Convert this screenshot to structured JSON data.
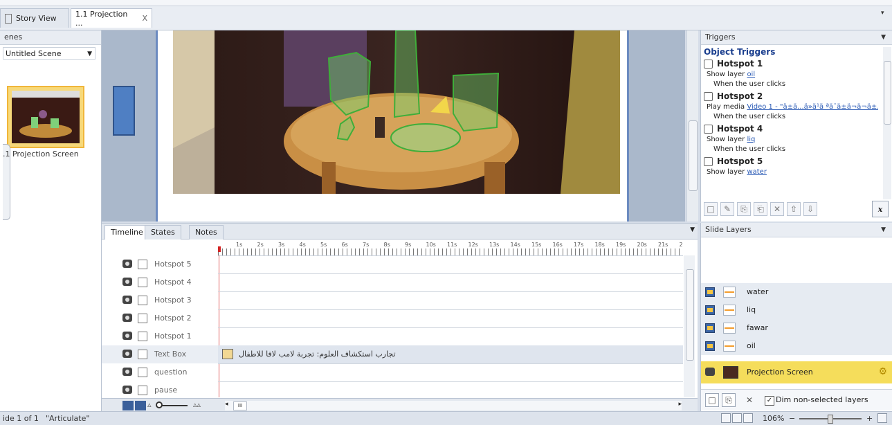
{
  "tabs": [
    {
      "label": "Story View",
      "active": false
    },
    {
      "label": "1.1 Projection ...",
      "active": true,
      "close": "X"
    }
  ],
  "scenes": {
    "header": "enes",
    "selected_scene": "Untitled Scene",
    "slide_label": ".1 Projection Screen"
  },
  "triggers": {
    "header": "Triggers",
    "section_title": "Object Triggers",
    "items": [
      {
        "hotspot": "Hotspot 1",
        "action": "Show layer ",
        "target": "oil",
        "when": "When the user clicks"
      },
      {
        "hotspot": "Hotspot 2",
        "action": "Play media ",
        "target": "Video 1 - \"ä±ä...ä»ä¹ä ªä¨ä±ä¬ä¬ä±...",
        "when": "When the user clicks"
      },
      {
        "hotspot": "Hotspot 4",
        "action": "Show layer ",
        "target": "liq",
        "when": "When the user clicks"
      },
      {
        "hotspot": "Hotspot 5",
        "action": "Show layer ",
        "target": "water",
        "when": ""
      }
    ],
    "variable_button": "x"
  },
  "timeline": {
    "tabs": [
      "Timeline",
      "States",
      "Notes"
    ],
    "ruler": [
      "1s",
      "2s",
      "3s",
      "4s",
      "5s",
      "6s",
      "7s",
      "8s",
      "9s",
      "10s",
      "11s",
      "12s",
      "13s",
      "14s",
      "15s",
      "16s",
      "17s",
      "18s",
      "19s",
      "20s",
      "21s",
      "2"
    ],
    "rows": [
      {
        "name": "Hotspot 5"
      },
      {
        "name": "Hotspot 4"
      },
      {
        "name": "Hotspot 3"
      },
      {
        "name": "Hotspot 2"
      },
      {
        "name": "Hotspot 1"
      },
      {
        "name": "Text Box",
        "text": "تجارب استكشاف العلوم: تجربة  لامب لافا للاطفال"
      },
      {
        "name": "question"
      },
      {
        "name": "pause"
      }
    ],
    "hscroll_thumb": "III"
  },
  "layers": {
    "header": "Slide Layers",
    "items": [
      "water",
      "liq",
      "fawar",
      "oil"
    ],
    "base_layer": "Projection Screen",
    "dim_label": "Dim non-selected layers",
    "dim_checked": "✓"
  },
  "status": {
    "slide": "ide 1 of 1",
    "theme": "\"Articulate\"",
    "zoom": "106%"
  }
}
